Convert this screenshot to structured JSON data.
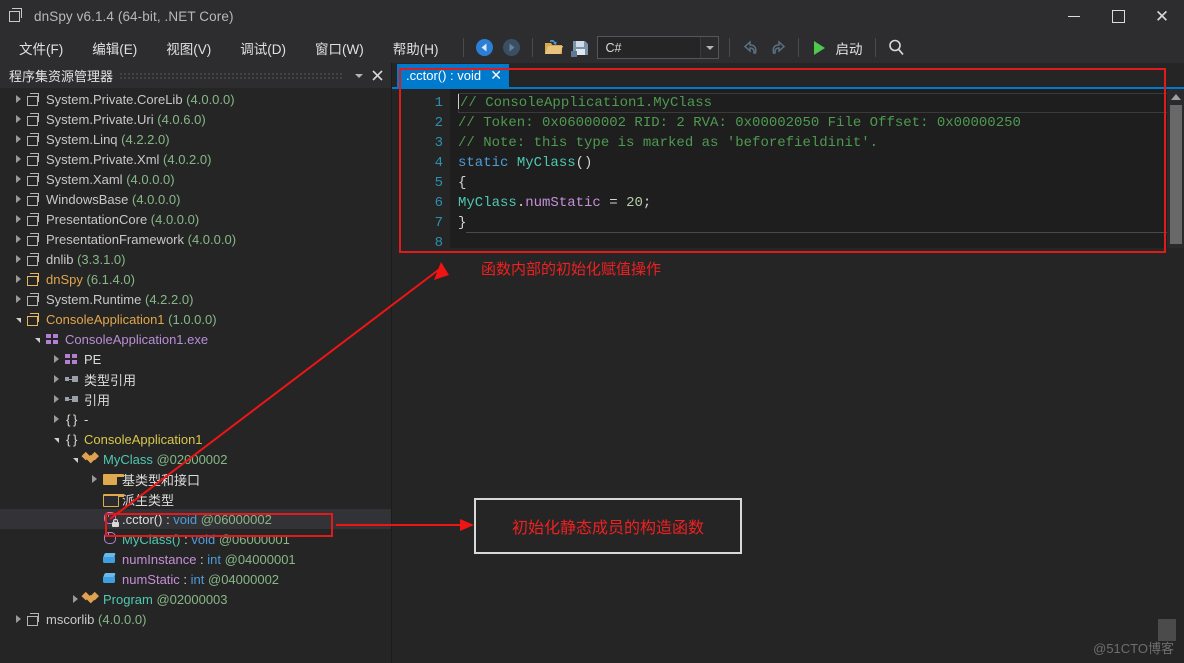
{
  "window": {
    "title": "dnSpy v6.1.4 (64-bit, .NET Core)",
    "icon": "assembly-icon",
    "controls": {
      "minimize": "–",
      "maximize": "□",
      "close": "✕"
    }
  },
  "menubar": {
    "items": [
      {
        "pre": "文件",
        "key": "F",
        "post": ")"
      },
      {
        "pre": "编辑",
        "key": "E",
        "post": ")"
      },
      {
        "pre": "视图",
        "key": "V",
        "post": ")"
      },
      {
        "pre": "调试",
        "key": "D",
        "post": ")"
      },
      {
        "pre": "窗口",
        "key": "W",
        "post": ")"
      },
      {
        "pre": "帮助",
        "key": "H",
        "post": ")"
      }
    ],
    "file_label": "文件(F)",
    "edit_label": "编辑(E)",
    "view_label": "视图(V)",
    "debug_label": "调试(D)",
    "window_label": "窗口(W)",
    "help_label": "帮助(H)"
  },
  "toolbar": {
    "back_icon": "back-arrow-icon",
    "forward_icon": "forward-arrow-icon",
    "open_icon": "open-folder-icon",
    "save_icon": "save-icon",
    "language_combo": {
      "value": "C#",
      "arrow": "chevron-down-icon"
    },
    "undo_icon": "undo-icon",
    "redo_icon": "redo-icon",
    "start_label": "启动",
    "play_icon": "play-icon",
    "search_icon": "search-icon"
  },
  "sidebar": {
    "title": "程序集资源管理器",
    "menu_icon": "chevron-down-icon",
    "close_icon": "close-icon",
    "tree": [
      {
        "indent": 0,
        "exp": "closed",
        "icon": "assembly",
        "label": "System.Private.CoreLib (4.0.0.0)",
        "name": "System.Private.CoreLib",
        "ver": "(4.0.0.0)",
        "color": "#c8c8c8",
        "vercolor": "#86b886"
      },
      {
        "indent": 0,
        "exp": "closed",
        "icon": "assembly",
        "label": "System.Private.Uri (4.0.6.0)",
        "name": "System.Private.Uri",
        "ver": "(4.0.6.0)",
        "color": "#c8c8c8",
        "vercolor": "#86b886"
      },
      {
        "indent": 0,
        "exp": "closed",
        "icon": "assembly",
        "label": "System.Linq (4.2.2.0)",
        "name": "System.Linq",
        "ver": "(4.2.2.0)",
        "color": "#c8c8c8",
        "vercolor": "#86b886"
      },
      {
        "indent": 0,
        "exp": "closed",
        "icon": "assembly",
        "label": "System.Private.Xml (4.0.2.0)",
        "name": "System.Private.Xml",
        "ver": "(4.0.2.0)",
        "color": "#c8c8c8",
        "vercolor": "#86b886"
      },
      {
        "indent": 0,
        "exp": "closed",
        "icon": "assembly",
        "label": "System.Xaml (4.0.0.0)",
        "name": "System.Xaml",
        "ver": "(4.0.0.0)",
        "color": "#c8c8c8",
        "vercolor": "#86b886"
      },
      {
        "indent": 0,
        "exp": "closed",
        "icon": "assembly",
        "label": "WindowsBase (4.0.0.0)",
        "name": "WindowsBase",
        "ver": "(4.0.0.0)",
        "color": "#c8c8c8",
        "vercolor": "#86b886"
      },
      {
        "indent": 0,
        "exp": "closed",
        "icon": "assembly",
        "label": "PresentationCore (4.0.0.0)",
        "name": "PresentationCore",
        "ver": "(4.0.0.0)",
        "color": "#c8c8c8",
        "vercolor": "#86b886"
      },
      {
        "indent": 0,
        "exp": "closed",
        "icon": "assembly",
        "label": "PresentationFramework (4.0.0.0)",
        "name": "PresentationFramework",
        "ver": "(4.0.0.0)",
        "color": "#c8c8c8",
        "vercolor": "#86b886"
      },
      {
        "indent": 0,
        "exp": "closed",
        "icon": "assembly",
        "label": "dnlib (3.3.1.0)",
        "name": "dnlib",
        "ver": "(3.3.1.0)",
        "color": "#c8c8c8",
        "vercolor": "#86b886"
      },
      {
        "indent": 0,
        "exp": "closed",
        "icon": "assembly-gold",
        "label": "dnSpy (6.1.4.0)",
        "name": "dnSpy",
        "ver": "(6.1.4.0)",
        "color": "#e0a64a",
        "vercolor": "#86b886"
      },
      {
        "indent": 0,
        "exp": "closed",
        "icon": "assembly",
        "label": "System.Runtime (4.2.2.0)",
        "name": "System.Runtime",
        "ver": "(4.2.2.0)",
        "color": "#c8c8c8",
        "vercolor": "#86b886"
      },
      {
        "indent": 0,
        "exp": "open",
        "icon": "assembly-gold",
        "label": "ConsoleApplication1 (1.0.0.0)",
        "name": "ConsoleApplication1",
        "ver": "(1.0.0.0)",
        "color": "#e0a64a",
        "vercolor": "#86b886"
      },
      {
        "indent": 1,
        "exp": "open",
        "icon": "module",
        "label": "ConsoleApplication1.exe",
        "name": "ConsoleApplication1.exe",
        "ver": "",
        "color": "#b98fd8",
        "vercolor": "#86b886"
      },
      {
        "indent": 2,
        "exp": "closed",
        "icon": "module",
        "label": "PE",
        "name": "PE",
        "ver": "",
        "color": "#dcdcdc",
        "vercolor": "#86b886"
      },
      {
        "indent": 2,
        "exp": "closed",
        "icon": "reference",
        "label": "类型引用",
        "name": "类型引用",
        "ver": "",
        "color": "#dcdcdc",
        "vercolor": "#86b886"
      },
      {
        "indent": 2,
        "exp": "closed",
        "icon": "reference",
        "label": "引用",
        "name": "引用",
        "ver": "",
        "color": "#dcdcdc",
        "vercolor": "#86b886"
      },
      {
        "indent": 2,
        "exp": "closed",
        "icon": "namespace",
        "label": "-",
        "name": "-",
        "ver": "",
        "color": "#dcdcdc",
        "vercolor": "#86b886"
      },
      {
        "indent": 2,
        "exp": "open",
        "icon": "namespace",
        "label": "ConsoleApplication1",
        "name": "ConsoleApplication1",
        "ver": "",
        "color": "#d8c84a",
        "vercolor": "#86b886"
      },
      {
        "indent": 3,
        "exp": "open",
        "icon": "class",
        "label": "MyClass @02000002",
        "name": "MyClass",
        "ver": "@02000002",
        "color": "#4ec9b0",
        "vercolor": "#86b886"
      },
      {
        "indent": 4,
        "exp": "closed",
        "icon": "folder",
        "label": "基类型和接口",
        "name": "基类型和接口",
        "ver": "",
        "color": "#dcdcdc",
        "vercolor": "#86b886"
      },
      {
        "indent": 4,
        "exp": "none",
        "icon": "folder-open",
        "label": "派生类型",
        "name": "派生类型",
        "ver": "",
        "color": "#dcdcdc",
        "vercolor": "#86b886"
      },
      {
        "indent": 4,
        "exp": "none",
        "icon": "method-locked",
        "label": ".cctor() : void @06000002",
        "name": ".cctor()",
        "sep": " : ",
        "rettype": "void",
        "ver": "@06000002",
        "color": "#dcdcdc",
        "vercolor": "#86b886",
        "selected": true,
        "highlighted": true
      },
      {
        "indent": 4,
        "exp": "none",
        "icon": "method",
        "label": "MyClass() : void @06000001",
        "name": "MyClass()",
        "sep": " : ",
        "rettype": "void",
        "ver": "@06000001",
        "color": "#4ec9b0",
        "vercolor": "#86b886"
      },
      {
        "indent": 4,
        "exp": "none",
        "icon": "field",
        "label": "numInstance : int @04000001",
        "name": "numInstance",
        "sep": " : ",
        "rettype": "int",
        "ver": "@04000001",
        "color": "#c58fd8",
        "vercolor": "#86b886"
      },
      {
        "indent": 4,
        "exp": "none",
        "icon": "field",
        "label": "numStatic : int @04000002",
        "name": "numStatic",
        "sep": " : ",
        "rettype": "int",
        "ver": "@04000002",
        "color": "#c58fd8",
        "vercolor": "#86b886"
      },
      {
        "indent": 3,
        "exp": "closed",
        "icon": "class",
        "label": "Program @02000003",
        "name": "Program",
        "ver": "@02000003",
        "color": "#4ec9b0",
        "vercolor": "#86b886"
      },
      {
        "indent": 0,
        "exp": "closed",
        "icon": "assembly",
        "label": "mscorlib (4.0.0.0)",
        "name": "mscorlib",
        "ver": "(4.0.0.0)",
        "color": "#c8c8c8",
        "vercolor": "#86b886"
      }
    ]
  },
  "editor": {
    "tab": {
      "label": ".cctor() : void",
      "close_icon": "close-icon"
    },
    "line_numbers": [
      "1",
      "2",
      "3",
      "4",
      "5",
      "6",
      "7",
      "8"
    ],
    "code_lines": [
      {
        "n": 1,
        "tokens": [
          {
            "t": "// ConsoleApplication1.MyClass",
            "c": "cmt"
          }
        ]
      },
      {
        "n": 2,
        "tokens": [
          {
            "t": "// Token: 0x06000002 RID: 2 RVA: 0x00002050 File Offset: 0x00000250",
            "c": "cmt"
          }
        ]
      },
      {
        "n": 3,
        "tokens": [
          {
            "t": "// Note: this type is marked as 'beforefieldinit'.",
            "c": "cmt"
          }
        ]
      },
      {
        "n": 4,
        "tokens": [
          {
            "t": "static ",
            "c": "kw"
          },
          {
            "t": "MyClass",
            "c": "type"
          },
          {
            "t": "()",
            "c": "pl"
          }
        ]
      },
      {
        "n": 5,
        "tokens": [
          {
            "t": "{",
            "c": "pl"
          }
        ]
      },
      {
        "n": 6,
        "tokens": [
          {
            "t": "    ",
            "c": "ind"
          },
          {
            "t": "MyClass",
            "c": "type"
          },
          {
            "t": ".",
            "c": "pl"
          },
          {
            "t": "numStatic",
            "c": "fld"
          },
          {
            "t": " = ",
            "c": "pl"
          },
          {
            "t": "20",
            "c": "num"
          },
          {
            "t": ";",
            "c": "pl"
          }
        ]
      },
      {
        "n": 7,
        "tokens": [
          {
            "t": "}",
            "c": "pl"
          }
        ]
      },
      {
        "n": 8,
        "tokens": []
      }
    ],
    "scrollbar": {
      "up_icon": "scroll-up-arrow-icon",
      "thumb": "scroll-thumb"
    }
  },
  "annotations": {
    "text1": "函数内部的初始化赋值操作",
    "box1": "初始化静态成员的构造函数",
    "color": "#ef2020",
    "arrow1": "arrow-to-annotation-text",
    "arrow2": "arrow-to-annotation-box"
  },
  "watermark": {
    "text": "@51CTO博客"
  }
}
